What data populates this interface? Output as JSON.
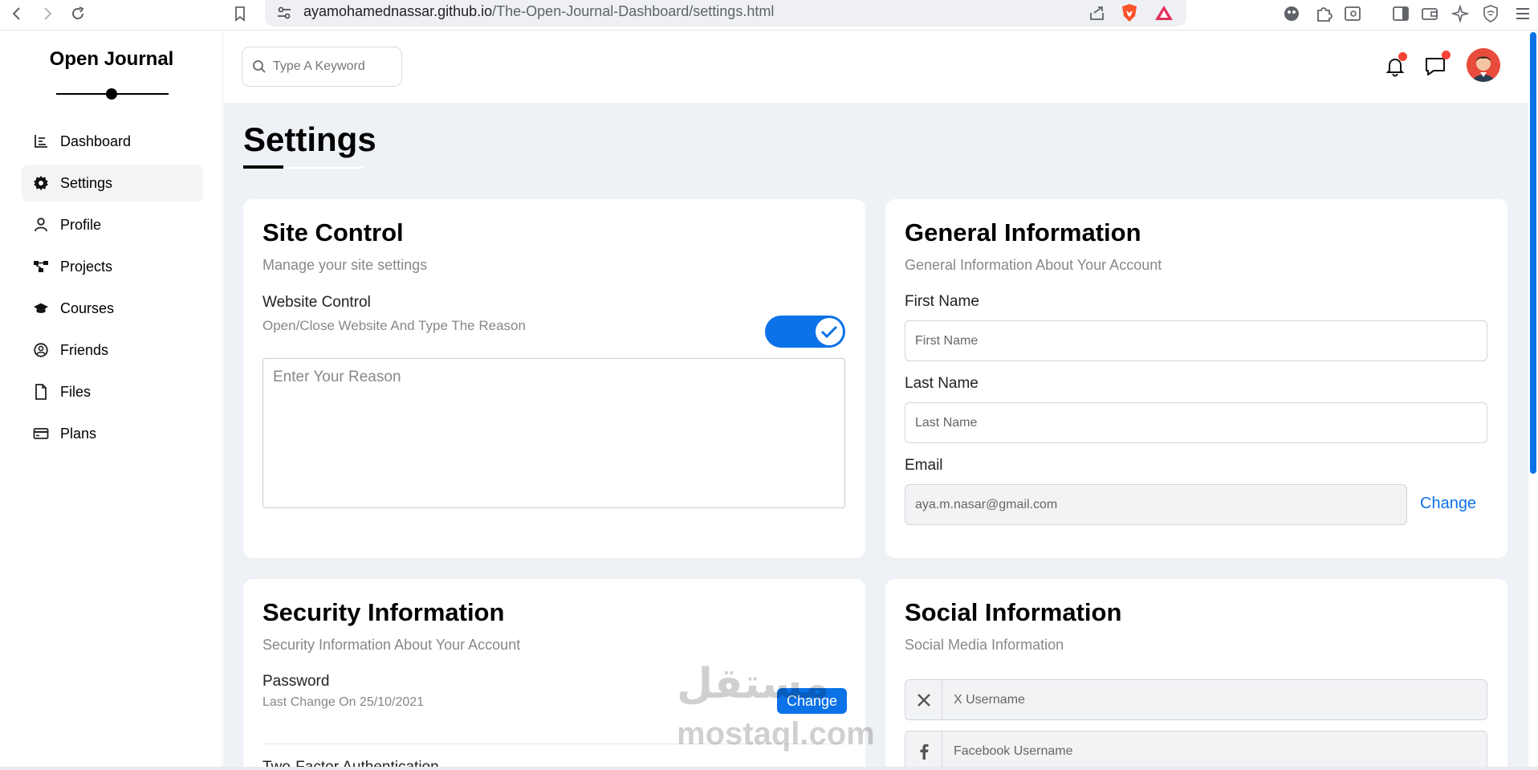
{
  "browser": {
    "url_host": "ayamohamednassar.github.io",
    "url_path": "/The-Open-Journal-Dashboard/settings.html"
  },
  "sidebar": {
    "logo": "Open Journal",
    "items": [
      {
        "label": "Dashboard",
        "icon": "chart-icon",
        "active": false
      },
      {
        "label": "Settings",
        "icon": "gear-icon",
        "active": true
      },
      {
        "label": "Profile",
        "icon": "user-icon",
        "active": false
      },
      {
        "label": "Projects",
        "icon": "diagram-icon",
        "active": false
      },
      {
        "label": "Courses",
        "icon": "graduation-cap-icon",
        "active": false
      },
      {
        "label": "Friends",
        "icon": "user-circle-icon",
        "active": false
      },
      {
        "label": "Files",
        "icon": "file-icon",
        "active": false
      },
      {
        "label": "Plans",
        "icon": "credit-card-icon",
        "active": false
      }
    ]
  },
  "header": {
    "search_placeholder": "Type A Keyword"
  },
  "page": {
    "title": "Settings"
  },
  "site_control": {
    "title": "Site Control",
    "subtitle": "Manage your site settings",
    "website_control_label": "Website Control",
    "website_control_hint": "Open/Close Website And Type The Reason",
    "toggle_on": true,
    "reason_placeholder": "Enter Your Reason"
  },
  "general_info": {
    "title": "General Information",
    "subtitle": "General Information About Your Account",
    "first_name_label": "First Name",
    "first_name_placeholder": "First Name",
    "last_name_label": "Last Name",
    "last_name_placeholder": "Last Name",
    "email_label": "Email",
    "email_value": "aya.m.nasar@gmail.com",
    "change_label": "Change"
  },
  "security_info": {
    "title": "Security Information",
    "subtitle": "Security Information About Your Account",
    "password_label": "Password",
    "password_hint": "Last Change On 25/10/2021",
    "change_label": "Change",
    "two_factor_label": "Two-Factor Authentication"
  },
  "social_info": {
    "title": "Social Information",
    "subtitle": "Social Media Information",
    "x_placeholder": "X Username",
    "facebook_placeholder": "Facebook Username"
  },
  "watermark": {
    "arabic": "مستقل",
    "latin": "mostaql.com"
  },
  "colors": {
    "accent": "#0b72e7",
    "background": "#eef1f5",
    "badge": "#f44336"
  }
}
